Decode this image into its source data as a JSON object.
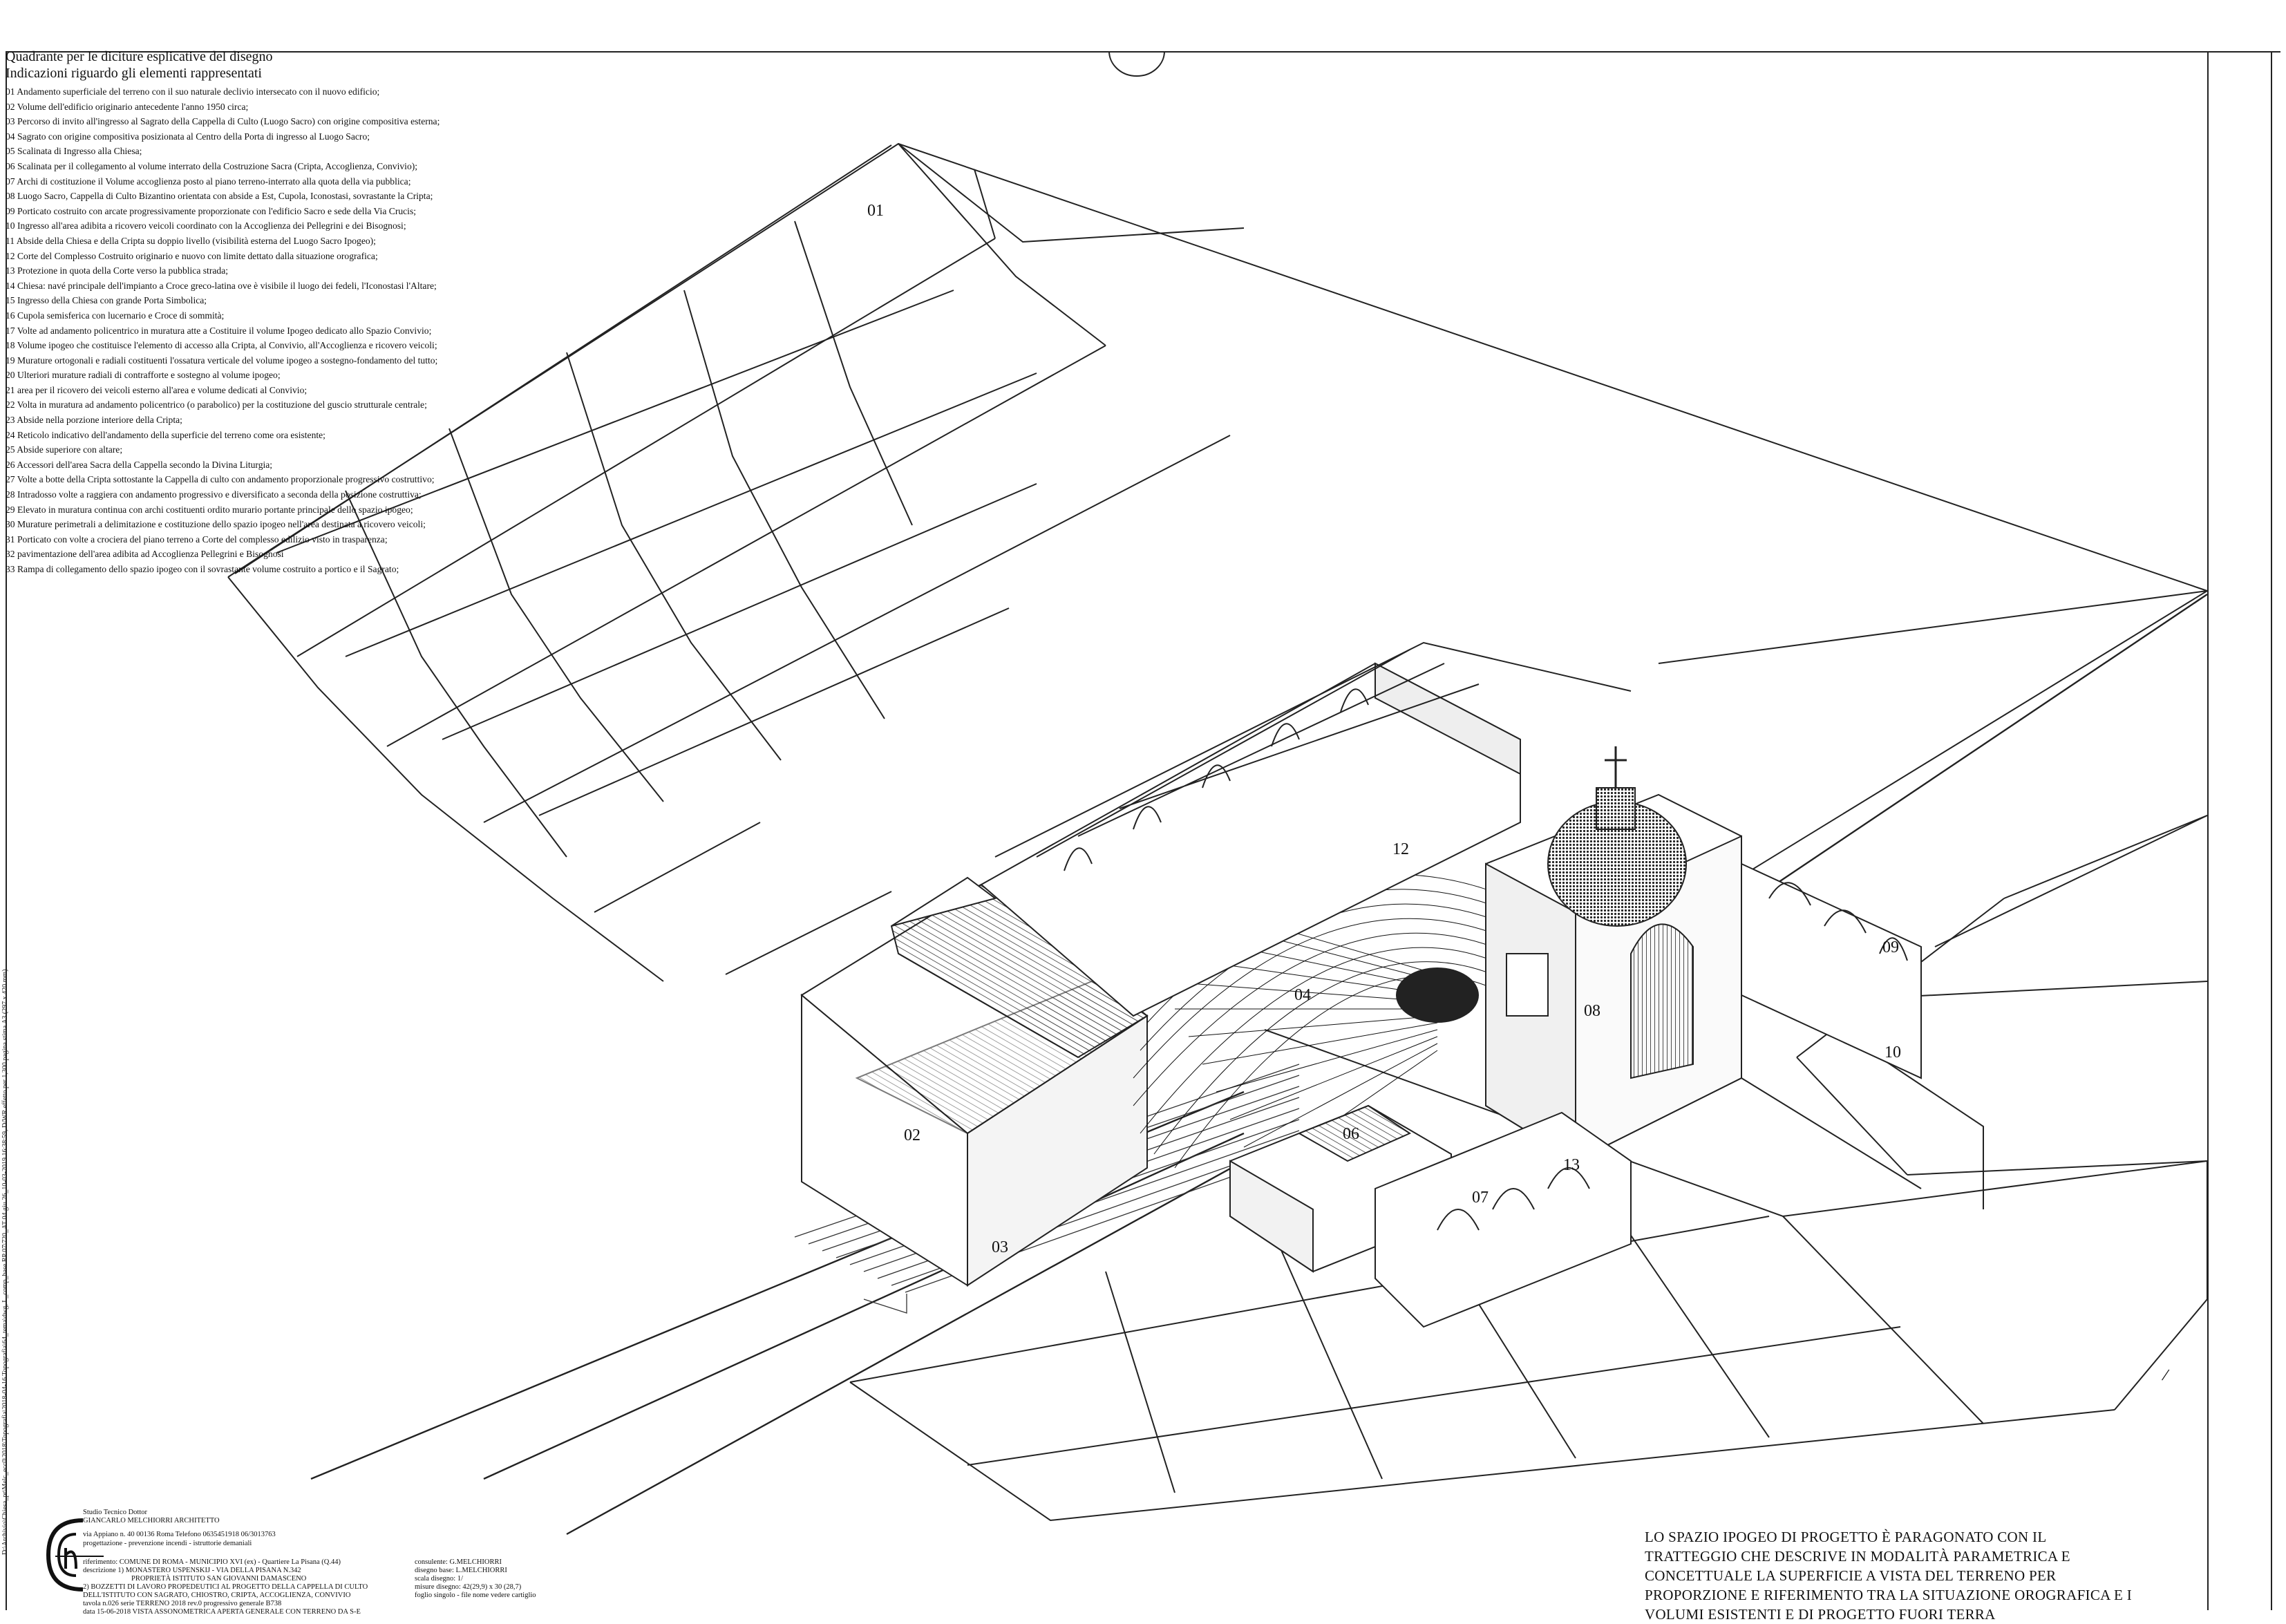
{
  "legend": {
    "title": "Quadrante per le diciture esplicative del disegno",
    "subtitle": "Indicazioni riguardo gli elementi rappresentati",
    "items": [
      "01 Andamento superficiale del terreno con il suo naturale declivio intersecato con il nuovo edificio;",
      "02 Volume dell'edificio originario antecedente l'anno 1950 circa;",
      "03 Percorso di invito all'ingresso al Sagrato della Cappella di Culto (Luogo Sacro) con origine compositiva esterna;",
      "04 Sagrato con origine compositiva posizionata al Centro della Porta di ingresso al Luogo Sacro;",
      "05 Scalinata di Ingresso alla Chiesa;",
      "06 Scalinata per il collegamento al volume interrato della Costruzione Sacra (Cripta, Accoglienza, Convivio);",
      "07 Archi di costituzione il Volume accoglienza posto al piano terreno-interrato alla quota della via pubblica;",
      "08 Luogo Sacro, Cappella di Culto Bizantino orientata con abside a Est, Cupola, Iconostasi, sovrastante la Cripta;",
      "09 Porticato costruito con arcate progressivamente proporzionate con l'edificio Sacro e sede della Via Crucis;",
      "10 Ingresso all'area adibita a ricovero veicoli coordinato con la Accoglienza dei Pellegrini e dei Bisognosi;",
      "11 Abside della Chiesa e della Cripta su doppio livello (visibilità esterna del Luogo Sacro Ipogeo);",
      "12 Corte del Complesso Costruito originario e nuovo con limite dettato dalla situazione orografica;",
      "13 Protezione in quota della Corte verso la pubblica strada;",
      "14 Chiesa: navé principale dell'impianto a Croce greco-latina ove è visibile il luogo dei fedeli, l'Iconostasi l'Altare;",
      "15 Ingresso della Chiesa con grande Porta Simbolica;",
      "16 Cupola semisferica con lucernario e Croce di sommità;",
      "17 Volte ad andamento policentrico in muratura atte a Costituire il volume Ipogeo dedicato allo Spazio Convivio;",
      "18 Volume ipogeo che costituisce l'elemento di accesso alla Cripta, al Convivio, all'Accoglienza e ricovero veicoli;",
      "19 Murature ortogonali e radiali costituenti l'ossatura verticale del volume ipogeo a sostegno-fondamento del tutto;",
      "20 Ulteriori murature radiali di contrafforte e sostegno al volume ipogeo;",
      "21 area per il ricovero dei veicoli esterno all'area e volume dedicati al Convivio;",
      "22 Volta in muratura ad andamento policentrico (o parabolico) per la costituzione del guscio strutturale centrale;",
      "23 Abside nella porzione interiore della Cripta;",
      "24 Reticolo indicativo dell'andamento della superficie del terreno come ora esistente;",
      "25 Abside superiore con altare;",
      "26 Accessori dell'area Sacra della Cappella secondo la Divina Liturgia;",
      "27 Volte a botte della Cripta sottostante la Cappella di culto con andamento proporzionale progressivo costruttivo;",
      "28 Intradosso volte a raggiera con andamento progressivo e diversificato a seconda della posizione costruttiva;",
      "29 Elevato in muratura continua con archi costituenti ordito murario portante principale dello spazio ipogeo;",
      "30 Murature perimetrali a delimitazione e costituzione dello spazio ipogeo nell'area destinata a ricovero veicoli;",
      "31 Porticato con volte a crociera del piano terreno a Corte del complesso edilizio visto in trasparenza;",
      "32 pavimentazione dell'area adibita ad Accoglienza Pellegrini e Bisognosi",
      "33 Rampa di collegamento dello spazio ipogeo con il sovrastante volume costruito a portico e il Sagrato;"
    ]
  },
  "drawing_labels": {
    "l01": "01",
    "l02": "02",
    "l03": "03",
    "l04": "04",
    "l06": "06",
    "l07": "07",
    "l08": "08",
    "l09": "09",
    "l10": "10",
    "l12": "12",
    "l13": "13"
  },
  "side_path": "D:\\Archivio\\Chiesa_pr\\Melc_ecc0\\2018\\Topografia\\2018-04-16 Topografia\\64_tema\\dwg, L_comp_base RP 07\\720_AT 04 giu 26_10-03-2019 16:38:59, D/WR effetto per 1,300 pagina stima A3 (297 x 420 mm)",
  "title_block": {
    "studio": "Studio Tecnico Dottor",
    "architect": "GIANCARLO MELCHIORRI ARCHITETTO",
    "address": "via Appiano n. 40    00136 Roma   Telefono 0635451918 06/3013763",
    "services": "progettazione       -        prevenzione incendi        -        istruttorie demaniali",
    "ref1": "riferimento:  COMUNE DI ROMA - MUNICIPIO XVI (ex)  - Quartiere La Pisana (Q.44)",
    "ref2": "descrizione 1) MONASTERO USPENSKIJ - VIA DELLA PISANA N.342",
    "ref3": "PROPRIETÀ ISTITUTO SAN GIOVANNI DAMASCENO",
    "ref4": "2) BOZZETTI DI LAVORO PROPEDEUTICI AL PROGETTO DELLA CAPPELLA DI CULTO",
    "ref5": "DELL'ISTITUTO CON SAGRATO, CHIOSTRO, CRIPTA, ACCOGLIENZA, CONVIVIO",
    "ref6": "tavola n.026  serie  TERRENO 2018 rev.0         progressivo generale B738",
    "ref7": "data 15-06-2018      VISTA ASSONOMETRICA APERTA GENERALE  CON TERRENO DA S-E",
    "col1": "consulente: G.MELCHIORRI",
    "col2": "disegno base: L.MELCHIORRI",
    "col3": "scala disegno: 1/",
    "col4": "misure disegno: 42(29,9) x 30 (28,7)",
    "col5": "foglio singolo - file nome vedere cartiglio"
  },
  "caption": [
    "LO SPAZIO IPOGEO DI PROGETTO È PARAGONATO CON IL",
    "TRATTEGGIO CHE DESCRIVE IN MODALITÀ PARAMETRICA E",
    "CONCETTUALE LA SUPERFICIE A VISTA DEL TERRENO PER",
    "PROPORZIONE E RIFERIMENTO TRA LA SITUAZIONE OROGRAFICA E I",
    "VOLUMI ESISTENTI E DI PROGETTO FUORI TERRA"
  ],
  "tick_mark": "/"
}
